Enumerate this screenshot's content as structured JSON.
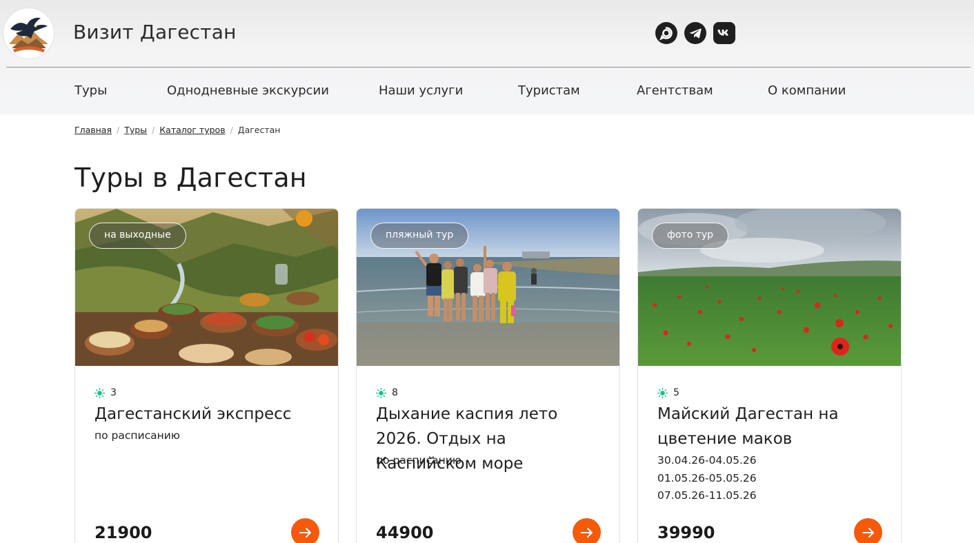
{
  "site": {
    "title": "Визит Дагестан"
  },
  "socials": [
    {
      "icon": "max-messenger-icon"
    },
    {
      "icon": "telegram-icon"
    },
    {
      "icon": "vk-icon"
    }
  ],
  "nav": {
    "items": [
      "Туры",
      "Однодневные экскурсии",
      "Наши услуги",
      "Туристам",
      "Агентствам",
      "О компании"
    ]
  },
  "breadcrumb": {
    "links": [
      "Главная",
      "Туры",
      "Каталог туров"
    ],
    "separator": "/",
    "current": "Дагестан"
  },
  "page": {
    "title": "Туры в Дагестан"
  },
  "colors": {
    "accent": "#f55a0b",
    "duration_icon": "#1fbf8f"
  },
  "cards": [
    {
      "badge": "на выходные",
      "duration": "3",
      "title": "Дагестанский экспресс",
      "dates": [
        "по расписанию"
      ],
      "price": "21900",
      "photo": "food-mountains-photo"
    },
    {
      "badge": "пляжный тур",
      "duration": "8",
      "title": "Дыхание каспия лето 2026. Отдых на Каспийском море",
      "dates": [
        "по расписанию"
      ],
      "price": "44900",
      "photo": "beach-group-photo"
    },
    {
      "badge": "фото тур",
      "duration": "5",
      "title": "Майский Дагестан на цветение маков",
      "dates": [
        "30.04.26-04.05.26",
        "01.05.26-05.05.26",
        "07.05.26-11.05.26"
      ],
      "price": "39990",
      "photo": "poppy-field-photo"
    }
  ]
}
